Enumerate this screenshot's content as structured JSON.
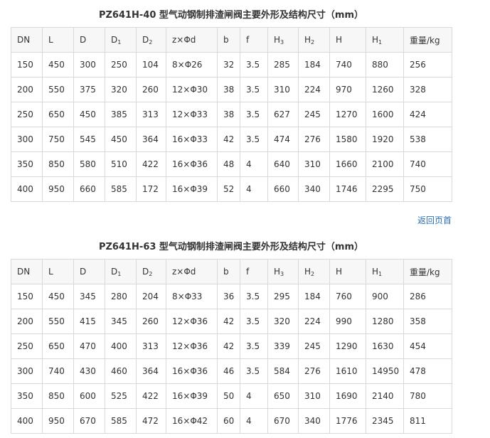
{
  "columns": [
    {
      "main": "DN",
      "sub": ""
    },
    {
      "main": "L",
      "sub": ""
    },
    {
      "main": "D",
      "sub": ""
    },
    {
      "main": "D",
      "sub": "1"
    },
    {
      "main": "D",
      "sub": "2"
    },
    {
      "main": "z×Φd",
      "sub": ""
    },
    {
      "main": "b",
      "sub": ""
    },
    {
      "main": "f",
      "sub": ""
    },
    {
      "main": "H",
      "sub": "3"
    },
    {
      "main": "H",
      "sub": "2"
    },
    {
      "main": "H",
      "sub": ""
    },
    {
      "main": "H",
      "sub": "1"
    },
    {
      "main": "重量/kg",
      "sub": ""
    }
  ],
  "tables": [
    {
      "title": "PZ641H-40 型气动钢制排渣闸阀主要外形及结构尺寸（mm）",
      "rows": [
        [
          "150",
          "450",
          "300",
          "250",
          "104",
          "8×Φ26",
          "32",
          "3.5",
          "285",
          "184",
          "740",
          "880",
          "256"
        ],
        [
          "200",
          "550",
          "375",
          "320",
          "260",
          "12×Φ30",
          "38",
          "3.5",
          "310",
          "224",
          "970",
          "1260",
          "328"
        ],
        [
          "250",
          "650",
          "450",
          "385",
          "313",
          "12×Φ33",
          "38",
          "3.5",
          "627",
          "245",
          "1270",
          "1600",
          "424"
        ],
        [
          "300",
          "750",
          "545",
          "450",
          "364",
          "16×Φ33",
          "42",
          "3.5",
          "474",
          "276",
          "1580",
          "1920",
          "538"
        ],
        [
          "350",
          "850",
          "580",
          "510",
          "422",
          "16×Φ36",
          "48",
          "4",
          "640",
          "310",
          "1660",
          "2100",
          "740"
        ],
        [
          "400",
          "950",
          "660",
          "585",
          "172",
          "16×Φ39",
          "52",
          "4",
          "660",
          "340",
          "1746",
          "2295",
          "750"
        ]
      ]
    },
    {
      "title": "PZ641H-63 型气动钢制排渣闸阀主要外形及结构尺寸（mm）",
      "rows": [
        [
          "150",
          "450",
          "345",
          "280",
          "204",
          "8×Φ33",
          "36",
          "3.5",
          "295",
          "184",
          "760",
          "900",
          "286"
        ],
        [
          "200",
          "550",
          "415",
          "345",
          "260",
          "12×Φ36",
          "42",
          "3.5",
          "320",
          "224",
          "990",
          "1280",
          "358"
        ],
        [
          "250",
          "650",
          "470",
          "400",
          "313",
          "12×Φ36",
          "42",
          "3.5",
          "339",
          "245",
          "1290",
          "1630",
          "454"
        ],
        [
          "300",
          "740",
          "430",
          "460",
          "364",
          "16×Φ36",
          "46",
          "3.5",
          "584",
          "276",
          "1610",
          "14950",
          "478"
        ],
        [
          "350",
          "850",
          "600",
          "525",
          "422",
          "16×Φ39",
          "50",
          "4",
          "650",
          "310",
          "1690",
          "2140",
          "780"
        ],
        [
          "400",
          "950",
          "670",
          "585",
          "472",
          "16×Φ42",
          "60",
          "4",
          "670",
          "340",
          "1776",
          "2345",
          "811"
        ]
      ]
    }
  ],
  "back_link": "返回页首"
}
